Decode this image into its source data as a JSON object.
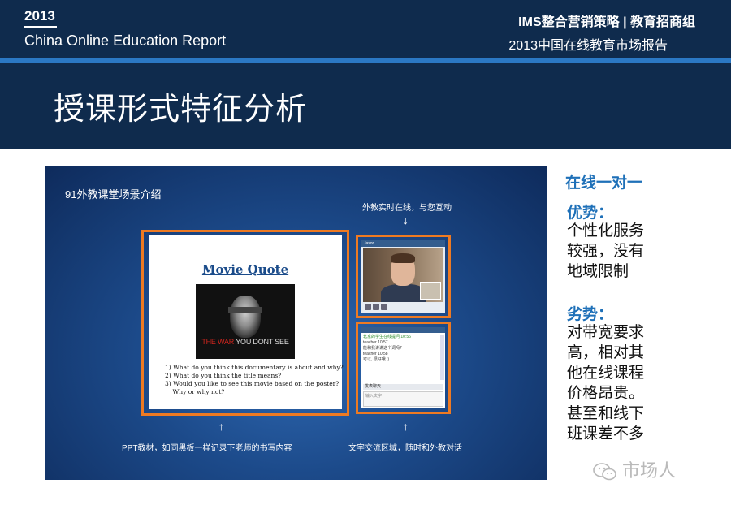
{
  "header": {
    "year": "2013",
    "report_en": "China Online Education Report",
    "right_line1": "IMS整合营销策略 | 教育招商组",
    "right_line2": "2013中国在线教育市场报告"
  },
  "page_title": "授课形式特征分析",
  "screenshot": {
    "title": "91外教课堂场景介绍",
    "annot_top": "外教实时在线，与您互动",
    "annot_left": "PPT教材，如同黑板一样记录下老师的书写内容",
    "annot_right": "文字交流区域，随时和外教对话",
    "slide": {
      "title": "Movie Quote",
      "poster_caption_red": "THE WAR",
      "poster_caption_white": " YOU DONT SEE",
      "questions": [
        "1) What do you think this documentary is about and why?",
        "2) What do you think the title means?",
        "3) Would you like to see this movie based on the poster?",
        "    Why or why not?"
      ]
    },
    "video": {
      "name": "Jason"
    },
    "chat": {
      "lines": [
        "北京的学生在线提问 10:56",
        "teacher 10:57",
        "能和我讲讲这个词吗?",
        "teacher 10:58",
        "可以, 很好哦 :)"
      ],
      "toolbar": "发表聊天",
      "input_placeholder": "输入文字"
    }
  },
  "side": {
    "title": "在线一对一",
    "adv_heading": "优势：",
    "adv_lines": [
      "个性化服务",
      "较强，没有",
      "地域限制"
    ],
    "dis_heading": "劣势：",
    "dis_lines": [
      "对带宽要求",
      "高，相对其",
      "他在线课程",
      "价格昂贵。",
      "甚至和线下",
      "班课差不多"
    ]
  },
  "watermark": "市场人",
  "colors": {
    "navy": "#0f2b4d",
    "accent_blue": "#2b78c4",
    "orange_frame": "#ee7a22",
    "side_blue": "#1e70b8"
  }
}
